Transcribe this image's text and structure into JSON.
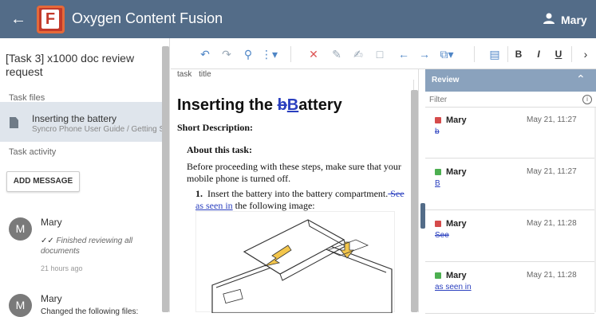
{
  "app": {
    "title": "Oxygen Content Fusion",
    "logo_letter": "F",
    "user": "Mary",
    "brand_color": "#536c88"
  },
  "left_panel": {
    "task_title": "[Task 3] x1000 doc review request",
    "task_files_label": "Task files",
    "file": {
      "name": "Inserting the battery",
      "path": "Syncro Phone User Guide / Getting Started"
    },
    "task_activity_label": "Task activity",
    "add_message_label": "ADD MESSAGE",
    "messages": [
      {
        "avatar": "M",
        "author": "Mary",
        "text": "Finished reviewing all documents",
        "time": "21 hours ago"
      },
      {
        "avatar": "M",
        "author": "Mary",
        "text": "Changed the following files:"
      }
    ]
  },
  "toolbar": {
    "buttons": [
      "undo-icon",
      "redo-icon",
      "search-icon",
      "more-vert-icon",
      "reject-icon",
      "add-comment-icon",
      "edit-comment-icon",
      "comment-icon",
      "prev-change-icon",
      "next-change-icon",
      "paste-icon",
      "insert-icon",
      "bold-icon",
      "italic-icon",
      "underline-icon",
      "chevron-right-icon"
    ],
    "bold_label": "B",
    "italic_label": "I",
    "underline_label": "U"
  },
  "breadcrumb": [
    "task",
    "title"
  ],
  "document": {
    "title_prefix": "Inserting the ",
    "title_deleted": "b",
    "title_inserted": "B",
    "title_suffix": "attery",
    "short_description": "Short Description:",
    "about_heading": "About this task:",
    "about_text": "Before proceeding with these steps, make sure that your mobile phone is turned off.",
    "step_number": "1.",
    "step_text_a": "Insert the battery into the battery compartment.",
    "step_deleted": " See",
    "step_inserted": "as seen in",
    "step_text_b": " the following image:"
  },
  "review": {
    "title": "Review",
    "filter_placeholder": "Filter",
    "items": [
      {
        "type": "delete",
        "author": "Mary",
        "time": "May 21, 11:27",
        "text": "b"
      },
      {
        "type": "insert",
        "author": "Mary",
        "time": "May 21, 11:27",
        "text": "B"
      },
      {
        "type": "delete",
        "author": "Mary",
        "time": "May 21, 11:28",
        "text": " See"
      },
      {
        "type": "insert",
        "author": "Mary",
        "time": "May 21, 11:28",
        "text": "as seen in"
      }
    ]
  }
}
